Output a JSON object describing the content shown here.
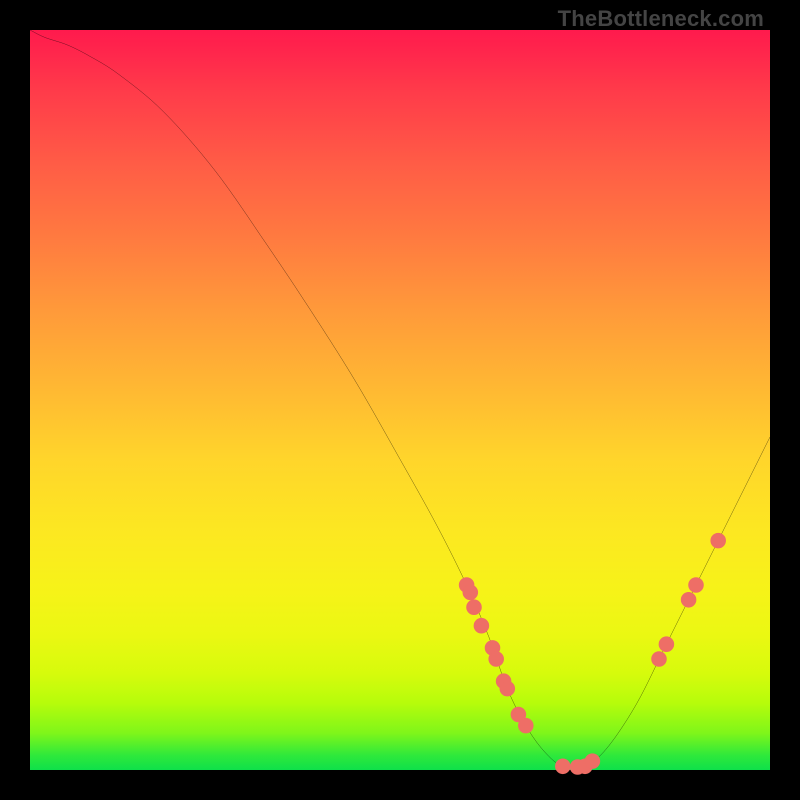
{
  "watermark": "TheBottleneck.com",
  "colors": {
    "background": "#000000",
    "curve_stroke": "#000000",
    "marker_fill": "#ee6e66",
    "marker_stroke": "#ee6e66",
    "gradient_top": "#ff1a4d",
    "gradient_bottom": "#0ee04a"
  },
  "chart_data": {
    "type": "line",
    "title": "",
    "xlabel": "",
    "ylabel": "",
    "xlim": [
      0,
      100
    ],
    "ylim": [
      0,
      100
    ],
    "grid": false,
    "legend": false,
    "series": [
      {
        "name": "bottleneck-curve",
        "x": [
          0,
          2,
          5,
          8,
          12,
          18,
          25,
          32,
          38,
          44,
          50,
          55,
          59,
          62,
          64.5,
          67,
          69.5,
          72,
          75,
          78,
          82,
          86,
          90,
          94,
          98,
          100
        ],
        "values": [
          100,
          99,
          98,
          96.5,
          94,
          89,
          81,
          71,
          62,
          52.5,
          42,
          33,
          25,
          18,
          11,
          6,
          2.5,
          0.5,
          0.5,
          3,
          9,
          17,
          25,
          33,
          41,
          45
        ]
      }
    ],
    "markers": {
      "name": "highlight-points",
      "x": [
        59,
        59.5,
        60,
        61,
        62.5,
        63,
        64,
        64.5,
        66,
        67,
        72,
        74,
        75,
        76,
        85,
        86,
        89,
        90,
        93
      ],
      "values": [
        25,
        24,
        22,
        19.5,
        16.5,
        15,
        12,
        11,
        7.5,
        6,
        0.5,
        0.4,
        0.5,
        1.2,
        15,
        17,
        23,
        25,
        31
      ]
    }
  }
}
